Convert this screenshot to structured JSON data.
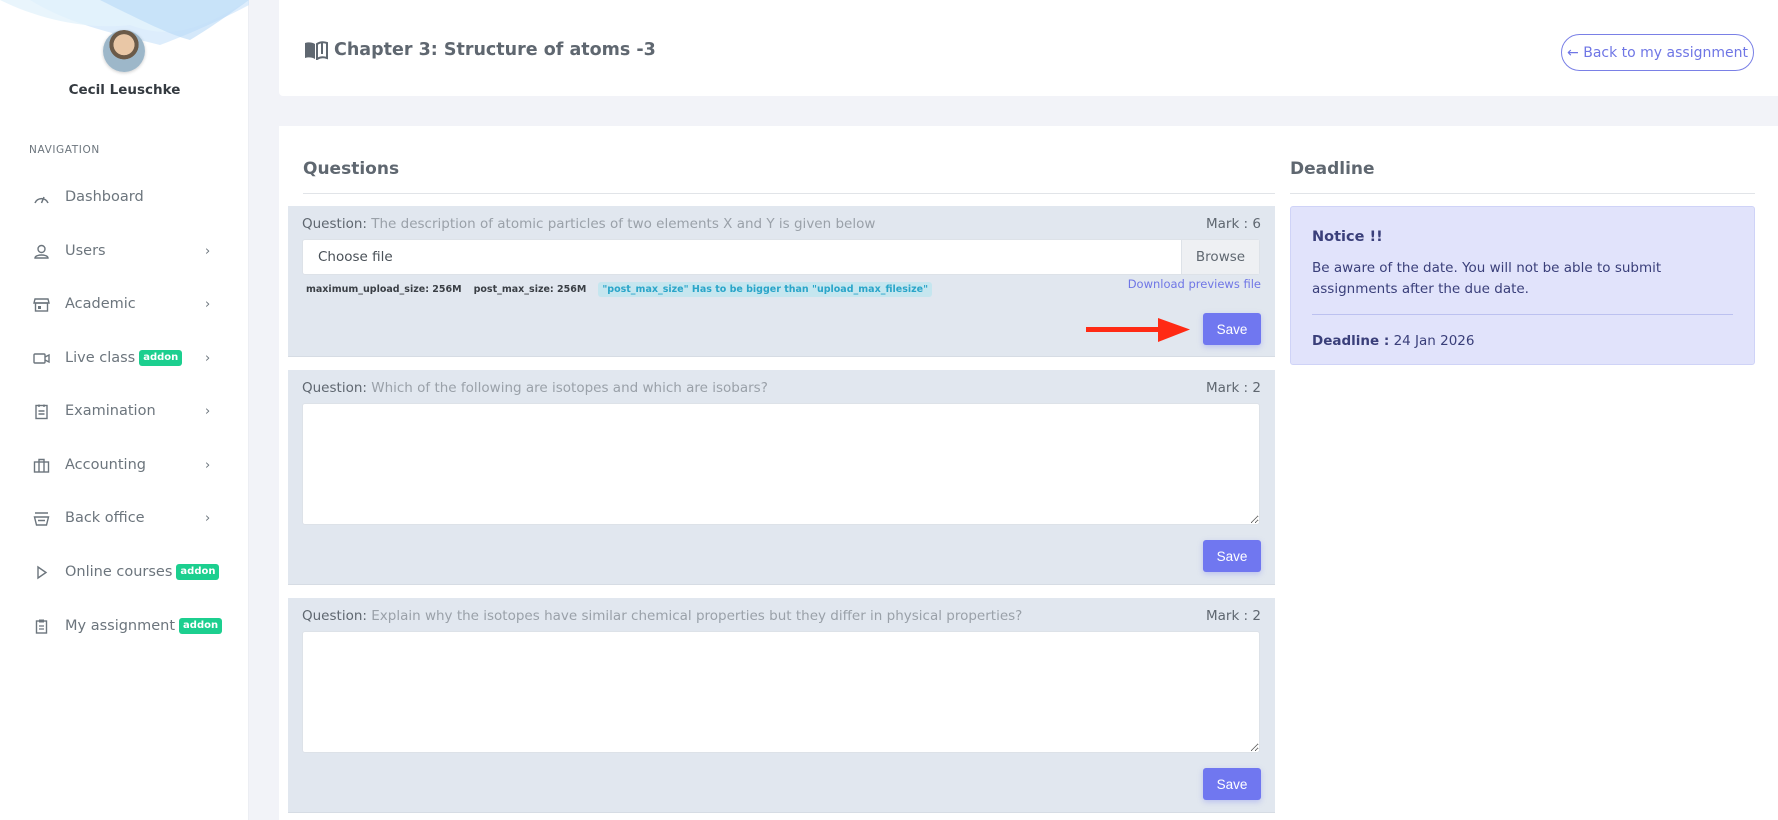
{
  "sidebar": {
    "user_name": "Cecil Leuschke",
    "nav_title": "NAVIGATION",
    "items": [
      {
        "label": "Dashboard",
        "icon": "gauge-icon",
        "has_chevron": false,
        "badge": null
      },
      {
        "label": "Users",
        "icon": "user-icon",
        "has_chevron": true,
        "badge": null
      },
      {
        "label": "Academic",
        "icon": "store-icon",
        "has_chevron": true,
        "badge": null
      },
      {
        "label": "Live class",
        "icon": "video-icon",
        "has_chevron": true,
        "badge": "addon"
      },
      {
        "label": "Examination",
        "icon": "clipboard-list-icon",
        "has_chevron": true,
        "badge": null
      },
      {
        "label": "Accounting",
        "icon": "briefcase-icon",
        "has_chevron": true,
        "badge": null
      },
      {
        "label": "Back office",
        "icon": "basket-icon",
        "has_chevron": true,
        "badge": null
      },
      {
        "label": "Online courses",
        "icon": "play-icon",
        "has_chevron": false,
        "badge": "addon"
      },
      {
        "label": "My assignment",
        "icon": "clipboard-icon",
        "has_chevron": false,
        "badge": "addon"
      }
    ],
    "chevron": "›"
  },
  "header": {
    "title": "Chapter 3: Structure of atoms -3",
    "back_button": "← Back to my assignment"
  },
  "questions_section": {
    "title": "Questions",
    "question_label": "Question:",
    "mark_label": "Mark :",
    "save_label": "Save",
    "items": [
      {
        "text": "The description of atomic particles of two elements X and Y is given below",
        "mark": "6",
        "type": "file",
        "file_placeholder": "Choose file",
        "browse_label": "Browse",
        "max_upload": "maximum_upload_size: 256M",
        "post_max": "post_max_size: 256M",
        "warning": "\"post_max_size\" Has to be bigger than \"upload_max_filesize\"",
        "download_link": "Download previews file"
      },
      {
        "text": "Which of the following are isotopes and which are isobars?",
        "mark": "2",
        "type": "text",
        "answer": ""
      },
      {
        "text": "Explain why the isotopes have similar chemical properties but they differ in physical properties?",
        "mark": "2",
        "type": "text",
        "answer": ""
      }
    ]
  },
  "deadline_section": {
    "title": "Deadline",
    "notice_title": "Notice !!",
    "notice_body": "Be aware of the date. You will not be able to submit assignments after the due date.",
    "deadline_label": "Deadline :",
    "deadline_value": "24 Jan 2026"
  },
  "colors": {
    "accent": "#7077f0",
    "addon_badge": "#1ccf8f",
    "question_bg": "#e1e7ef",
    "notice_bg": "#e1e3fb",
    "annotation_arrow": "#ff2a14"
  }
}
